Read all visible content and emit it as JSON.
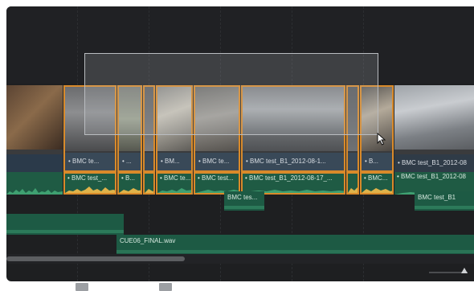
{
  "video_clips": [
    {
      "label": "",
      "selected": false
    },
    {
      "label": "• BMC te...",
      "selected": true
    },
    {
      "label": "• ...",
      "selected": true
    },
    {
      "label": "",
      "selected": true
    },
    {
      "label": "• BM...",
      "selected": true
    },
    {
      "label": "• BMC te...",
      "selected": true
    },
    {
      "label": "• BMC test_B1_2012-08-1...",
      "selected": true
    },
    {
      "label": "",
      "selected": true
    },
    {
      "label": "• B...",
      "selected": true
    },
    {
      "label": "• BMC test_B1_2012-08",
      "selected": false
    }
  ],
  "audio_clips": [
    {
      "label": "",
      "selected": false
    },
    {
      "label": "• BMC test_...",
      "selected": true
    },
    {
      "label": "• B...",
      "selected": true
    },
    {
      "label": "",
      "selected": true
    },
    {
      "label": "• BMC te...",
      "selected": true
    },
    {
      "label": "• BMC test...",
      "selected": true
    },
    {
      "label": "• BMC test_B1_2012-08-17_...",
      "selected": true
    },
    {
      "label": "",
      "selected": true
    },
    {
      "label": "• BMC...",
      "selected": true
    },
    {
      "label": "• BMC test_B1_2012-08",
      "selected": false
    }
  ],
  "connected_audio": [
    {
      "label": "BMC tes..."
    },
    {
      "label": "BMC test_B1"
    }
  ],
  "music_track": {
    "label": "CUE06_FINAL.wav"
  },
  "colors": {
    "selection_outline": "#d98a2a",
    "audio_clip": "#1f5b44",
    "clip_label_bar": "#2b3a4a",
    "timeline_bg": "#1e1f21"
  },
  "icons": [
    "pointer-cursor-icon",
    "bottom-tool-icon"
  ]
}
